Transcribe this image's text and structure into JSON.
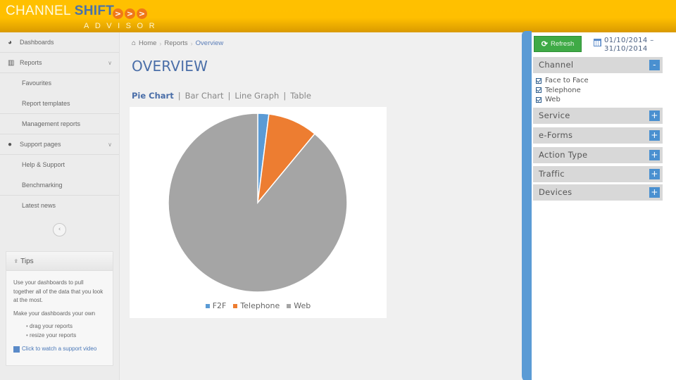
{
  "header": {
    "logo_channel": "CHANNEL ",
    "logo_shift": "SHIFT",
    "logo_sub": "ADVISOR",
    "logo_arrows": [
      ">",
      ">",
      ">"
    ],
    "background_color": "#ffc000"
  },
  "sidebar": {
    "items": [
      {
        "label": "Dashboards",
        "icon": "dashboard-icon",
        "type": "top"
      },
      {
        "label": "Reports",
        "icon": "bar-chart-icon",
        "type": "top",
        "expandable": true
      },
      {
        "label": "Favourites",
        "type": "sub"
      },
      {
        "label": "Report templates",
        "type": "sub",
        "last": true
      },
      {
        "label": "Management reports",
        "type": "sub-standalone"
      },
      {
        "label": "Support pages",
        "icon": "support-icon",
        "type": "top",
        "expandable": true
      },
      {
        "label": "Help & Support",
        "type": "sub"
      },
      {
        "label": "Benchmarking",
        "type": "sub",
        "last": true
      },
      {
        "label": "Latest news",
        "type": "sub-standalone"
      }
    ],
    "collapse_icon": "chevron-left-icon"
  },
  "tips": {
    "title": "Tips",
    "icon": "lightbulb-icon",
    "paragraph1": "Use your dashboards to pull together all of the data that you look at the most.",
    "paragraph2": "Make your dashboards your own",
    "bullets": [
      "drag your reports",
      "resize your reports"
    ],
    "video_link": "Click to watch a support video"
  },
  "breadcrumb": {
    "items": [
      "Home",
      "Reports",
      "Overview"
    ]
  },
  "page": {
    "title": "OVERVIEW",
    "view_tabs": [
      {
        "label": "Pie Chart",
        "active": true
      },
      {
        "label": "Bar Chart",
        "active": false
      },
      {
        "label": "Line Graph",
        "active": false
      },
      {
        "label": "Table",
        "active": false
      }
    ]
  },
  "chart_data": {
    "type": "pie",
    "title": "",
    "categories": [
      "F2F",
      "Telephone",
      "Web"
    ],
    "values": [
      2,
      9,
      89
    ],
    "colors": [
      "#5b9bd5",
      "#ed7d31",
      "#a5a5a5"
    ],
    "start_angle": "12 o'clock, clockwise",
    "legend_position": "bottom"
  },
  "right_panel": {
    "refresh_label": "Refresh",
    "date_from": "01/10/2014 –",
    "date_to": "31/10/2014",
    "accent_color": "#5b9bd5",
    "filters": [
      {
        "label": "Channel",
        "expanded": true,
        "toggle": "-",
        "options": [
          {
            "label": "Face to Face",
            "checked": true
          },
          {
            "label": "Telephone",
            "checked": true
          },
          {
            "label": "Web",
            "checked": true
          }
        ]
      },
      {
        "label": "Service",
        "expanded": false,
        "toggle": "+"
      },
      {
        "label": "e-Forms",
        "expanded": false,
        "toggle": "+"
      },
      {
        "label": "Action Type",
        "expanded": false,
        "toggle": "+"
      },
      {
        "label": "Traffic",
        "expanded": false,
        "toggle": "+"
      },
      {
        "label": "Devices",
        "expanded": false,
        "toggle": "+"
      }
    ]
  }
}
